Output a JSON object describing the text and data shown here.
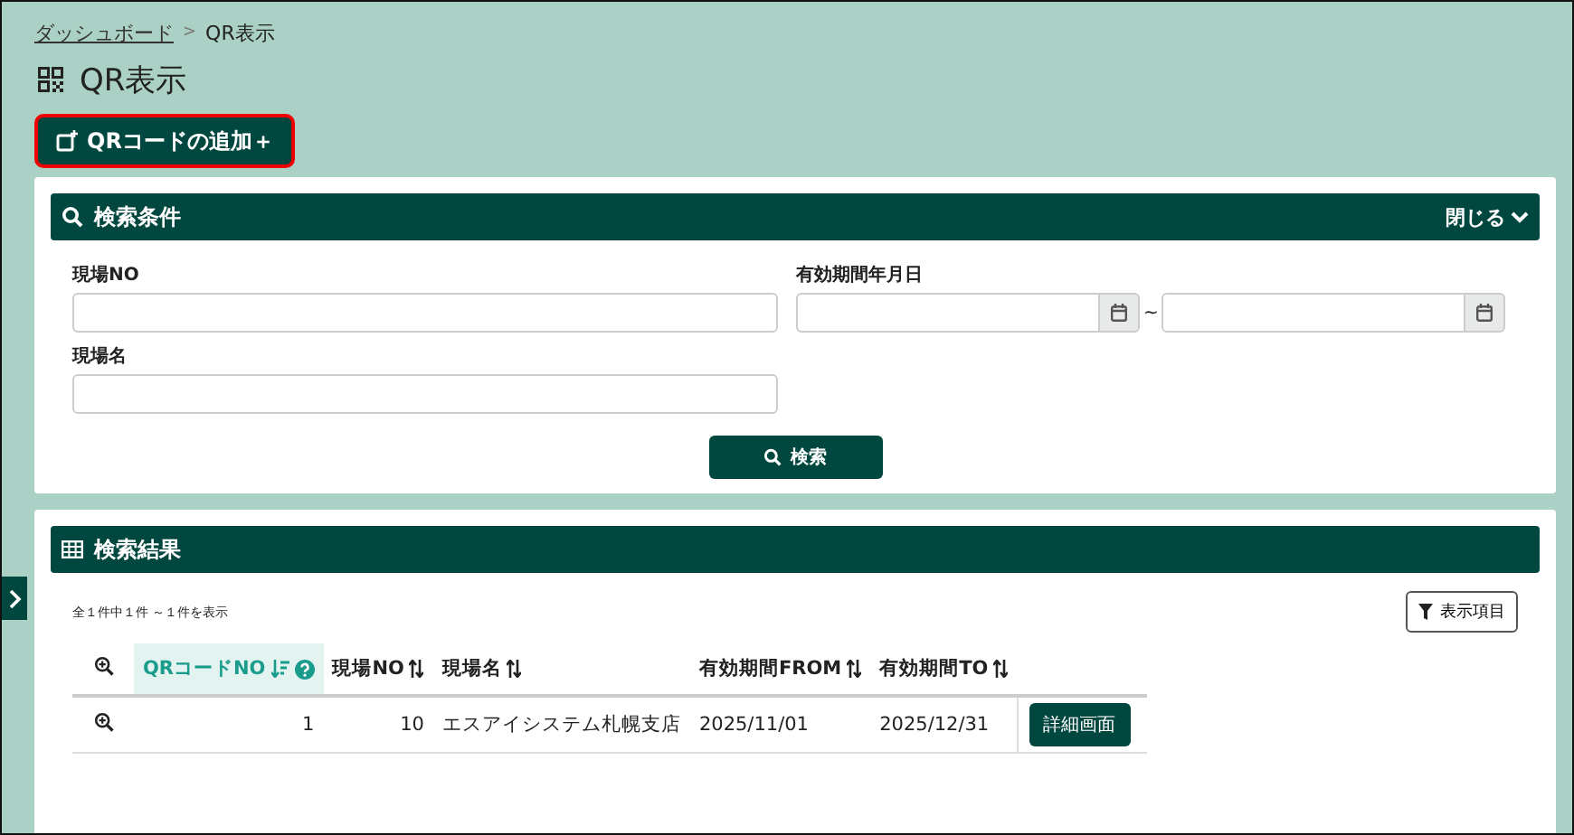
{
  "breadcrumb": {
    "link": "ダッシュボード",
    "separator": ">",
    "current": "QR表示"
  },
  "title": "QR表示",
  "add_button": "QRコードの追加＋",
  "search_panel": {
    "title": "検索条件",
    "toggle": "閉じる",
    "site_no_label": "現場NO",
    "period_label": "有効期間年月日",
    "range_separator": "~",
    "site_name_label": "現場名",
    "search_button": "検索"
  },
  "results_panel": {
    "title": "検索結果",
    "count": "全１件中１件 ～１件を表示",
    "columns_button": "表示項目",
    "table": {
      "columns": [
        {
          "label": "QRコードNO",
          "sorted": true,
          "help": true
        },
        {
          "label": "現場NO",
          "sorted": false,
          "help": false
        },
        {
          "label": "現場名",
          "sorted": false,
          "help": false
        },
        {
          "label": "有効期間FROM",
          "sorted": false,
          "help": false
        },
        {
          "label": "有効期間TO",
          "sorted": false,
          "help": false
        }
      ],
      "rows": [
        {
          "cells": [
            "1",
            "10",
            "エスアイシステム札幌支店",
            "2025/11/01",
            "2025/12/31"
          ],
          "action": "詳細画面"
        }
      ]
    }
  }
}
